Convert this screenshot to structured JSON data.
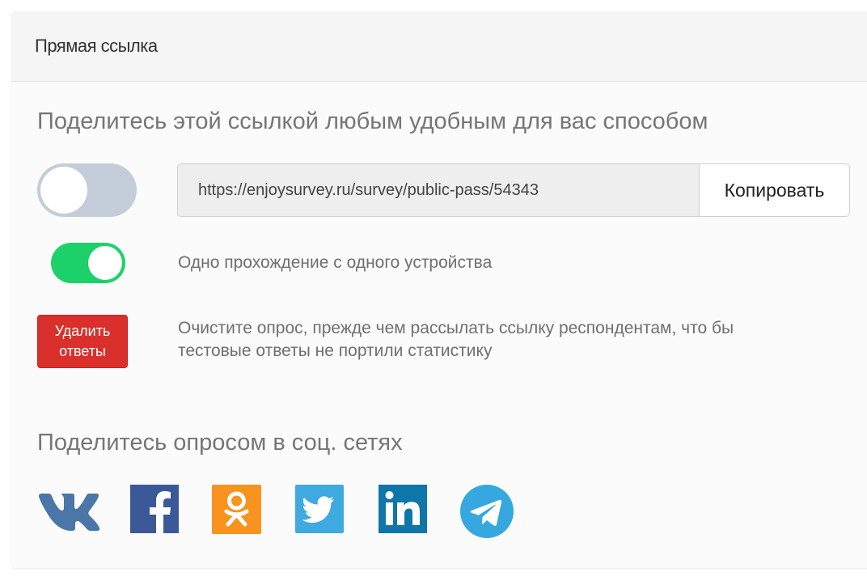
{
  "header": {
    "title": "Прямая ссылка"
  },
  "share_link": {
    "heading": "Поделитесь этой ссылкой любым удобным для вас способом",
    "url": "https://enjoysurvey.ru/survey/public-pass/54343",
    "copy_label": "Копировать",
    "link_toggle_on": false
  },
  "single_pass": {
    "label": "Одно прохождение с одного устройства",
    "toggle_on": true
  },
  "clear_answers": {
    "button_line1": "Удалить",
    "button_line2": "ответы",
    "hint_line1": "Очистите опрос, прежде чем рассылать ссылку респондентам, что бы",
    "hint_line2": "тестовые ответы не портили статистику"
  },
  "social": {
    "heading": "Поделитесь опросом в соц. сетях",
    "networks": [
      {
        "name": "vk",
        "icon": "vk-icon",
        "color": "#4a76a8"
      },
      {
        "name": "facebook",
        "icon": "facebook-icon",
        "color": "#3b5998"
      },
      {
        "name": "odnoklassniki",
        "icon": "odnoklassniki-icon",
        "color": "#f7931e"
      },
      {
        "name": "twitter",
        "icon": "twitter-icon",
        "color": "#3fa9e0"
      },
      {
        "name": "linkedin",
        "icon": "linkedin-icon",
        "color": "#0e76a8"
      },
      {
        "name": "telegram",
        "icon": "telegram-icon",
        "color": "#35a8df"
      }
    ]
  },
  "colors": {
    "toggle_off": "#c3cdd9",
    "toggle_on": "#1dd16a",
    "danger": "#d9302c"
  }
}
